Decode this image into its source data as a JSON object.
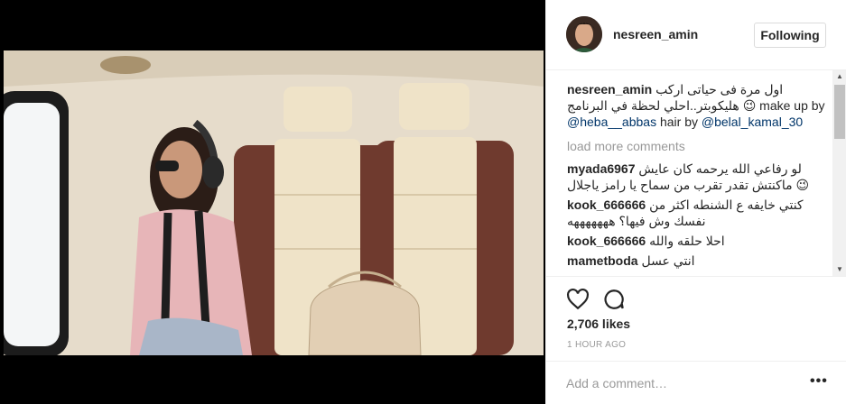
{
  "post": {
    "username": "nesreen_amin",
    "follow_label": "Following"
  },
  "caption": {
    "username": "nesreen_amin",
    "text_part1": "اول مرة فى حياتى اركب هليكوبتر..احلي لحظة في البرنامج 😉 make up by",
    "mention1": "@heba__abbas",
    "text_part2": "hair by",
    "mention2": "@belal_kamal_30"
  },
  "load_more": "load more comments",
  "comments": [
    {
      "user": "myada6967",
      "text": "لو رفاعي الله يرحمه كان عايش ماكنتش تقدر تقرب من سماح يا رامز ياجلال 😉"
    },
    {
      "user": "kook_666666",
      "text": "كنتي خايفه ع الشنطه اكثر من نفسك وش فيها؟ هههههههه"
    },
    {
      "user": "kook_666666",
      "text": "احلا حلقه والله"
    },
    {
      "user": "mametboda",
      "text": "انتي عسل"
    }
  ],
  "likes": "2,706 likes",
  "time": "1 HOUR AGO",
  "add_comment_placeholder": "Add a comment…",
  "more_label": "•••",
  "icons": {
    "like": "heart-icon",
    "comment": "comment-icon"
  },
  "colors": {
    "mention": "#003569",
    "muted": "#999999",
    "text": "#262626"
  }
}
